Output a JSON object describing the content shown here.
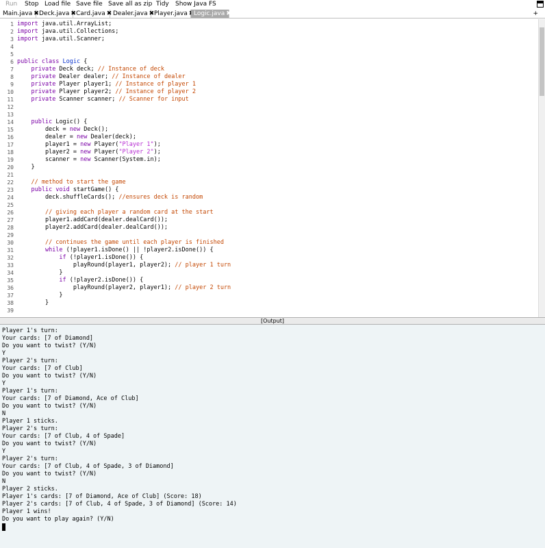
{
  "menu": {
    "run": "Run",
    "stop": "Stop",
    "load_file": "Load file",
    "save_file": "Save file",
    "save_zip": "Save all as zip",
    "tidy": "Tidy",
    "show_fs": "Show Java FS"
  },
  "tabs": [
    {
      "label": "Main.java",
      "close": "✖"
    },
    {
      "label": "Deck.java",
      "close": "✖"
    },
    {
      "label": "Card.java",
      "close": "✖"
    },
    {
      "label": "Dealer.java",
      "close": "✖"
    },
    {
      "label": "Player.java",
      "close": "✖"
    },
    {
      "label": "Logic.java",
      "close": "✖",
      "active": true
    }
  ],
  "tab_add": "+",
  "editor": {
    "line_numbers": [
      "1",
      "2",
      "3",
      "4",
      "5",
      "6",
      "7",
      "8",
      "9",
      "10",
      "11",
      "12",
      "13",
      "14",
      "15",
      "16",
      "17",
      "18",
      "19",
      "20",
      "21",
      "22",
      "23",
      "24",
      "25",
      "26",
      "27",
      "28",
      "29",
      "30",
      "31",
      "32",
      "33",
      "34",
      "35",
      "36",
      "37",
      "38",
      "39"
    ],
    "lines": [
      [
        {
          "t": "import",
          "c": "kw"
        },
        {
          "t": " java.util.ArrayList;"
        }
      ],
      [
        {
          "t": "import",
          "c": "kw"
        },
        {
          "t": " java.util.Collections;"
        }
      ],
      [
        {
          "t": "import",
          "c": "kw"
        },
        {
          "t": " java.util.Scanner;"
        }
      ],
      [],
      [],
      [
        {
          "t": "public class ",
          "c": "kw"
        },
        {
          "t": "Logic",
          "c": "cls"
        },
        {
          "t": " {"
        }
      ],
      [
        {
          "t": "    "
        },
        {
          "t": "private",
          "c": "kw"
        },
        {
          "t": " Deck deck; "
        },
        {
          "t": "// Instance of deck",
          "c": "cm"
        }
      ],
      [
        {
          "t": "    "
        },
        {
          "t": "private",
          "c": "kw"
        },
        {
          "t": " Dealer dealer; "
        },
        {
          "t": "// Instance of dealer",
          "c": "cm"
        }
      ],
      [
        {
          "t": "    "
        },
        {
          "t": "private",
          "c": "kw"
        },
        {
          "t": " Player player1; "
        },
        {
          "t": "// Instance of player 1",
          "c": "cm"
        }
      ],
      [
        {
          "t": "    "
        },
        {
          "t": "private",
          "c": "kw"
        },
        {
          "t": " Player player2; "
        },
        {
          "t": "// Instance of player 2",
          "c": "cm"
        }
      ],
      [
        {
          "t": "    "
        },
        {
          "t": "private",
          "c": "kw"
        },
        {
          "t": " Scanner scanner; "
        },
        {
          "t": "// Scanner for input",
          "c": "cm"
        }
      ],
      [],
      [],
      [
        {
          "t": "    "
        },
        {
          "t": "public",
          "c": "kw"
        },
        {
          "t": " Logic() {"
        }
      ],
      [
        {
          "t": "        deck = "
        },
        {
          "t": "new",
          "c": "kw"
        },
        {
          "t": " Deck();"
        }
      ],
      [
        {
          "t": "        dealer = "
        },
        {
          "t": "new",
          "c": "kw"
        },
        {
          "t": " Dealer(deck);"
        }
      ],
      [
        {
          "t": "        player1 = "
        },
        {
          "t": "new",
          "c": "kw"
        },
        {
          "t": " Player("
        },
        {
          "t": "\"Player 1\"",
          "c": "st"
        },
        {
          "t": ");"
        }
      ],
      [
        {
          "t": "        player2 = "
        },
        {
          "t": "new",
          "c": "kw"
        },
        {
          "t": " Player("
        },
        {
          "t": "\"Player 2\"",
          "c": "st"
        },
        {
          "t": ");"
        }
      ],
      [
        {
          "t": "        scanner = "
        },
        {
          "t": "new",
          "c": "kw"
        },
        {
          "t": " Scanner(System.in);"
        }
      ],
      [
        {
          "t": "    }"
        }
      ],
      [],
      [
        {
          "t": "    "
        },
        {
          "t": "// method to start the game",
          "c": "cm"
        }
      ],
      [
        {
          "t": "    "
        },
        {
          "t": "public void",
          "c": "kw"
        },
        {
          "t": " startGame() {"
        }
      ],
      [
        {
          "t": "        deck.shuffleCards(); "
        },
        {
          "t": "//ensures deck is random",
          "c": "cm"
        }
      ],
      [],
      [
        {
          "t": "        "
        },
        {
          "t": "// giving each player a random card at the start",
          "c": "cm"
        }
      ],
      [
        {
          "t": "        player1.addCard(dealer.dealCard());"
        }
      ],
      [
        {
          "t": "        player2.addCard(dealer.dealCard());"
        }
      ],
      [],
      [
        {
          "t": "        "
        },
        {
          "t": "// continues the game until each player is finished",
          "c": "cm"
        }
      ],
      [
        {
          "t": "        "
        },
        {
          "t": "while",
          "c": "kw"
        },
        {
          "t": " (!player1.isDone() || !player2.isDone()) {"
        }
      ],
      [
        {
          "t": "            "
        },
        {
          "t": "if",
          "c": "kw"
        },
        {
          "t": " (!player1.isDone()) {"
        }
      ],
      [
        {
          "t": "                playRound(player1, player2); "
        },
        {
          "t": "// player 1 turn",
          "c": "cm"
        }
      ],
      [
        {
          "t": "            }"
        }
      ],
      [
        {
          "t": "            "
        },
        {
          "t": "if",
          "c": "kw"
        },
        {
          "t": " (!player2.isDone()) {"
        }
      ],
      [
        {
          "t": "                playRound(player2, player1); "
        },
        {
          "t": "// player 2 turn",
          "c": "cm"
        }
      ],
      [
        {
          "t": "            }"
        }
      ],
      [
        {
          "t": "        }"
        }
      ],
      []
    ]
  },
  "output": {
    "header": "[Output]",
    "lines": [
      "Player 1's turn:",
      "Your cards: [7 of Diamond]",
      "Do you want to twist? (Y/N)",
      "Y",
      "Player 2's turn:",
      "Your cards: [7 of Club]",
      "Do you want to twist? (Y/N)",
      "Y",
      "Player 1's turn:",
      "Your cards: [7 of Diamond, Ace of Club]",
      "Do you want to twist? (Y/N)",
      "N",
      "Player 1 sticks.",
      "Player 2's turn:",
      "Your cards: [7 of Club, 4 of Spade]",
      "Do you want to twist? (Y/N)",
      "Y",
      "Player 2's turn:",
      "Your cards: [7 of Club, 4 of Spade, 3 of Diamond]",
      "Do you want to twist? (Y/N)",
      "N",
      "Player 2 sticks.",
      "Player 1's cards: [7 of Diamond, Ace of Club] (Score: 18)",
      "Player 2's cards: [7 of Club, 4 of Spade, 3 of Diamond] (Score: 14)",
      "Player 1 wins!",
      "Do you want to play again? (Y/N)"
    ]
  }
}
